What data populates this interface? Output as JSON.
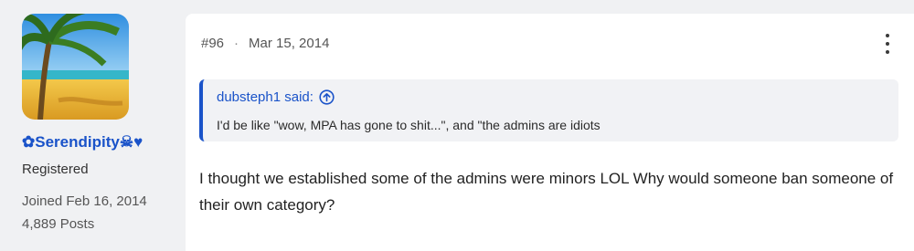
{
  "user": {
    "name": "✿Serendipity☠♥",
    "title": "Registered",
    "joined": "Joined Feb 16, 2014",
    "posts": "4,889 Posts"
  },
  "post": {
    "number": "#96",
    "separator": "·",
    "date": "Mar 15, 2014",
    "quote": {
      "author": "dubsteph1 said:",
      "text": "I'd be like \"wow, MPA has gone to shit...\", and \"the admins are idiots"
    },
    "body": "I thought we established some of the admins were minors LOL Why would someone ban someone of their own category?"
  },
  "icons": {
    "more": "more-vertical-icon",
    "quote_jump": "arrow-up-circle-icon"
  },
  "colors": {
    "accent": "#1a53c9",
    "page_bg": "#f0f1f3",
    "card_bg": "#ffffff",
    "quote_bg": "#f1f2f5"
  }
}
